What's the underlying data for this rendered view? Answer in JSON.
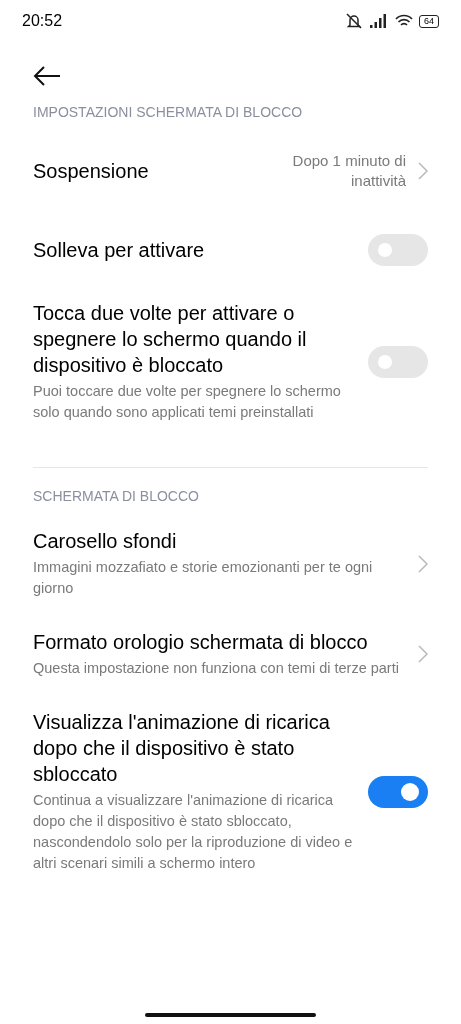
{
  "status_bar": {
    "time": "20:52",
    "battery": "64"
  },
  "sections": [
    {
      "header": "IMPOSTAZIONI SCHERMATA DI BLOCCO",
      "items": [
        {
          "kind": "value",
          "title": "Sospensione",
          "value": "Dopo 1 minuto di inattività"
        },
        {
          "kind": "toggle",
          "title": "Solleva per attivare",
          "on": false
        },
        {
          "kind": "toggle",
          "title": "Tocca due volte per attivare o spegnere lo schermo quando il dispositivo è bloccato",
          "subtitle": "Puoi toccare due volte per spegnere lo schermo solo quando sono applicati temi preinstallati",
          "on": false
        }
      ]
    },
    {
      "header": "SCHERMATA DI BLOCCO",
      "items": [
        {
          "kind": "link",
          "title": "Carosello sfondi",
          "subtitle": "Immagini mozzafiato e storie emozionanti per te ogni giorno"
        },
        {
          "kind": "link",
          "title": "Formato orologio schermata di blocco",
          "subtitle": "Questa impostazione non funziona con temi di terze parti"
        },
        {
          "kind": "toggle",
          "title": "Visualizza l'animazione di ricarica dopo che il dispositivo è stato sbloccato",
          "subtitle": "Continua a visualizzare l'animazione di ricarica dopo che il dispositivo è stato sbloccato, nascondendolo solo per la riproduzione di video e altri scenari simili a schermo intero",
          "on": true
        }
      ]
    }
  ]
}
